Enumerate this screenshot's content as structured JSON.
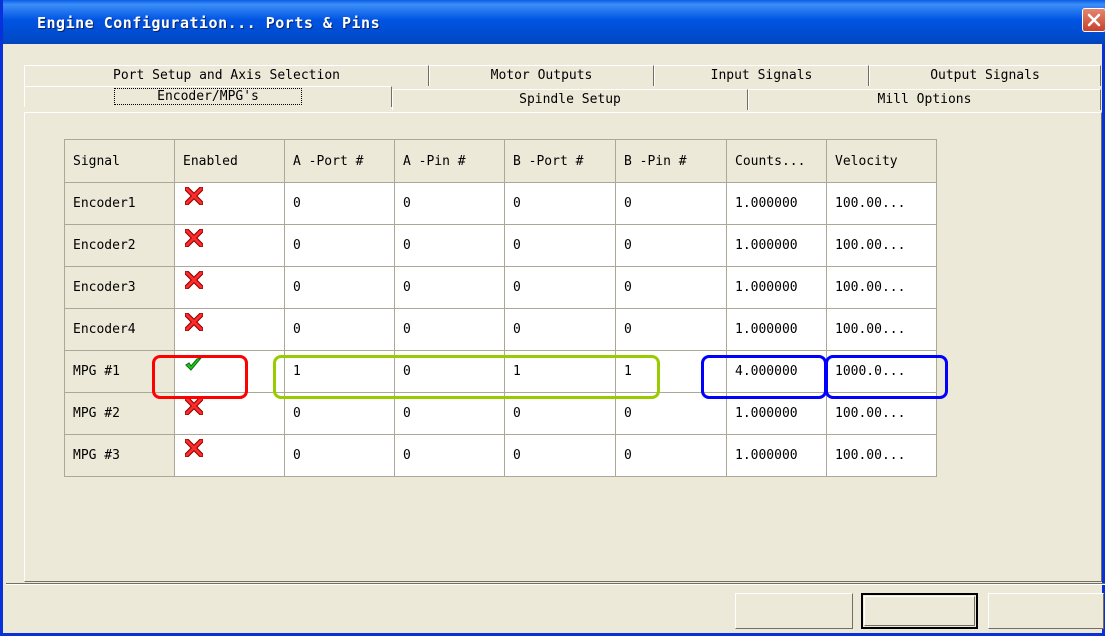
{
  "window": {
    "title": "Engine Configuration... Ports & Pins"
  },
  "tabs": {
    "row1": [
      "Port Setup and Axis Selection",
      "Motor Outputs",
      "Input Signals",
      "Output Signals"
    ],
    "row2": [
      "Encoder/MPG's",
      "Spindle Setup",
      "Mill Options"
    ],
    "active": "Encoder/MPG's"
  },
  "table": {
    "headers": [
      "Signal",
      "Enabled",
      "A -Port #",
      "A -Pin  #",
      "B -Port #",
      "B -Pin  #",
      "Counts...",
      "Velocity"
    ],
    "rows": [
      {
        "signal": "Encoder1",
        "enabled": false,
        "a_port": "0",
        "a_pin": "0",
        "b_port": "0",
        "b_pin": "0",
        "counts": "1.000000",
        "velocity": "100.00..."
      },
      {
        "signal": "Encoder2",
        "enabled": false,
        "a_port": "0",
        "a_pin": "0",
        "b_port": "0",
        "b_pin": "0",
        "counts": "1.000000",
        "velocity": "100.00..."
      },
      {
        "signal": "Encoder3",
        "enabled": false,
        "a_port": "0",
        "a_pin": "0",
        "b_port": "0",
        "b_pin": "0",
        "counts": "1.000000",
        "velocity": "100.00..."
      },
      {
        "signal": "Encoder4",
        "enabled": false,
        "a_port": "0",
        "a_pin": "0",
        "b_port": "0",
        "b_pin": "0",
        "counts": "1.000000",
        "velocity": "100.00..."
      },
      {
        "signal": "MPG #1",
        "enabled": true,
        "a_port": "1",
        "a_pin": "0",
        "b_port": "1",
        "b_pin": "1",
        "counts": "4.000000",
        "velocity": "1000.0..."
      },
      {
        "signal": "MPG #2",
        "enabled": false,
        "a_port": "0",
        "a_pin": "0",
        "b_port": "0",
        "b_pin": "0",
        "counts": "1.000000",
        "velocity": "100.00..."
      },
      {
        "signal": "MPG #3",
        "enabled": false,
        "a_port": "0",
        "a_pin": "0",
        "b_port": "0",
        "b_pin": "0",
        "counts": "1.000000",
        "velocity": "100.00..."
      }
    ]
  },
  "icons": {
    "enabled_true": "green-check-icon",
    "enabled_false": "red-x-icon"
  },
  "colors": {
    "title_bar": "#0054e3",
    "highlight_red": "#ff0000",
    "highlight_green": "#99cc00",
    "highlight_blue": "#0000ff"
  },
  "buttons": [
    "",
    "",
    ""
  ]
}
